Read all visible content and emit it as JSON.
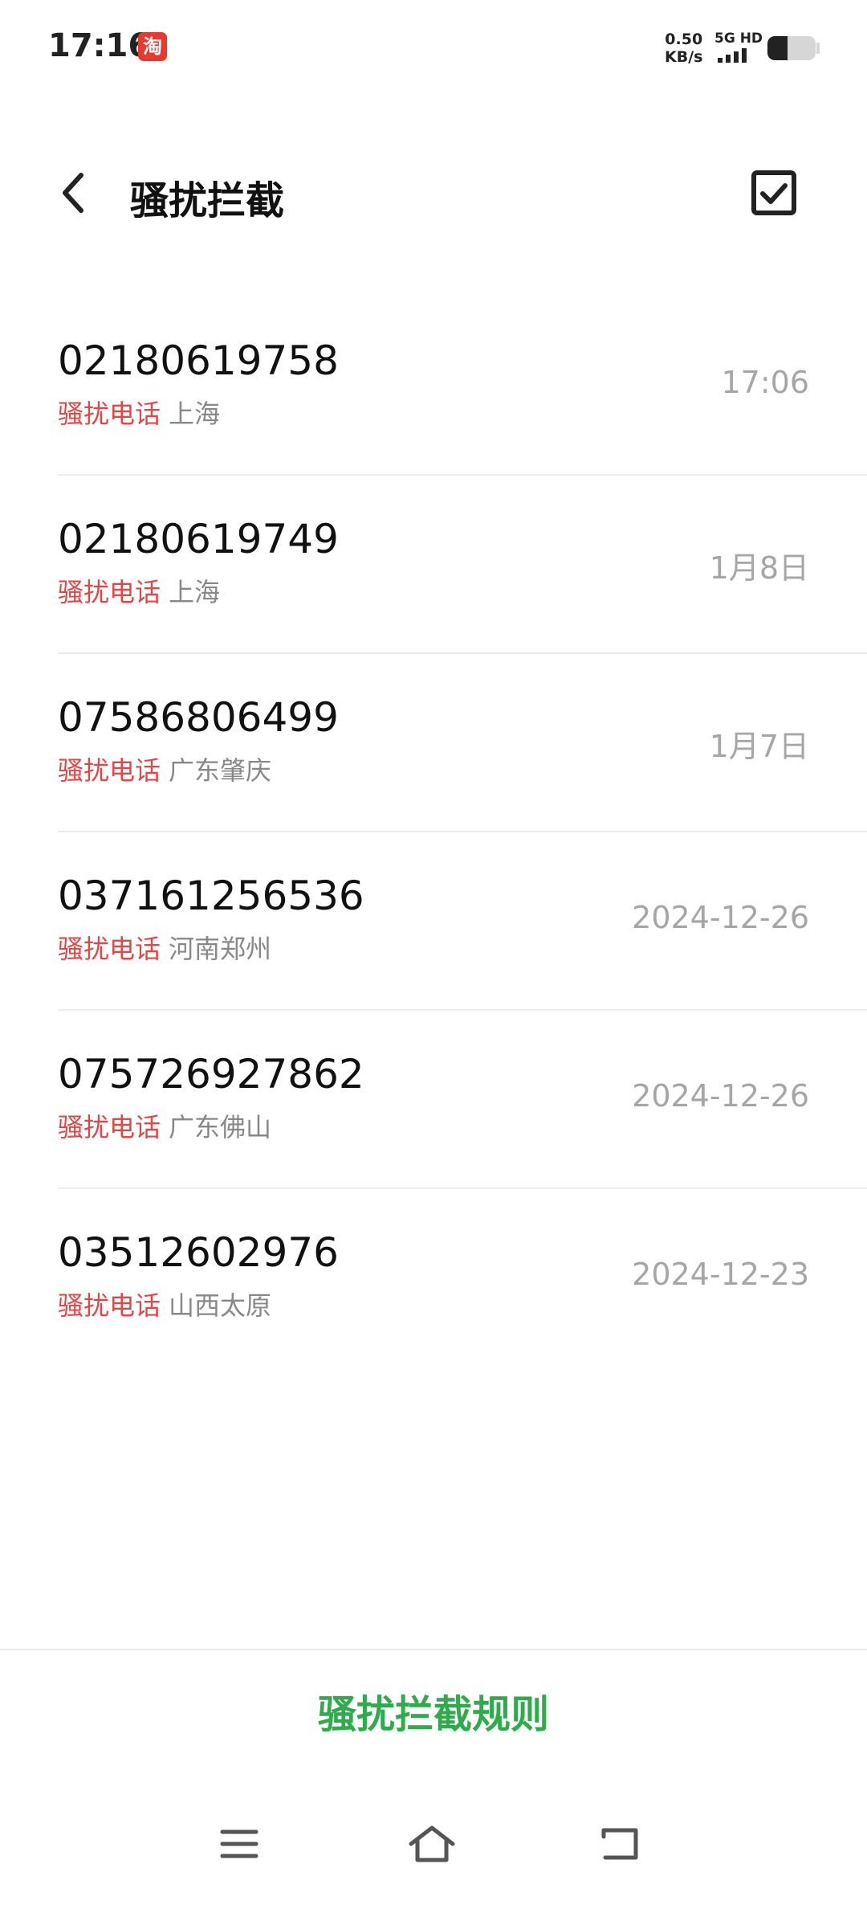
{
  "status_bar": {
    "time": "17:16",
    "app_badge": "淘",
    "speed_value": "0.50",
    "speed_unit": "KB/s",
    "network": "5G HD",
    "battery_level_percent": 42
  },
  "header": {
    "title": "骚扰拦截"
  },
  "calls": [
    {
      "number": "02180619758",
      "tag": "骚扰电话",
      "location": "上海",
      "date": "17:06"
    },
    {
      "number": "02180619749",
      "tag": "骚扰电话",
      "location": "上海",
      "date": "1月8日"
    },
    {
      "number": "07586806499",
      "tag": "骚扰电话",
      "location": "广东肇庆",
      "date": "1月7日"
    },
    {
      "number": "037161256536",
      "tag": "骚扰电话",
      "location": "河南郑州",
      "date": "2024-12-26"
    },
    {
      "number": "075726927862",
      "tag": "骚扰电话",
      "location": "广东佛山",
      "date": "2024-12-26"
    },
    {
      "number": "03512602976",
      "tag": "骚扰电话",
      "location": "山西太原",
      "date": "2024-12-23"
    }
  ],
  "footer": {
    "rules_label": "骚扰拦截规则"
  },
  "colors": {
    "tag_red": "#e04848",
    "accent_green": "#2eab4b",
    "date_gray": "#a6a6a6"
  },
  "icons": {
    "back": "back-arrow-icon",
    "select": "checkbox-icon",
    "nav_menu": "menu-icon",
    "nav_home": "home-icon",
    "nav_back": "back-icon"
  }
}
